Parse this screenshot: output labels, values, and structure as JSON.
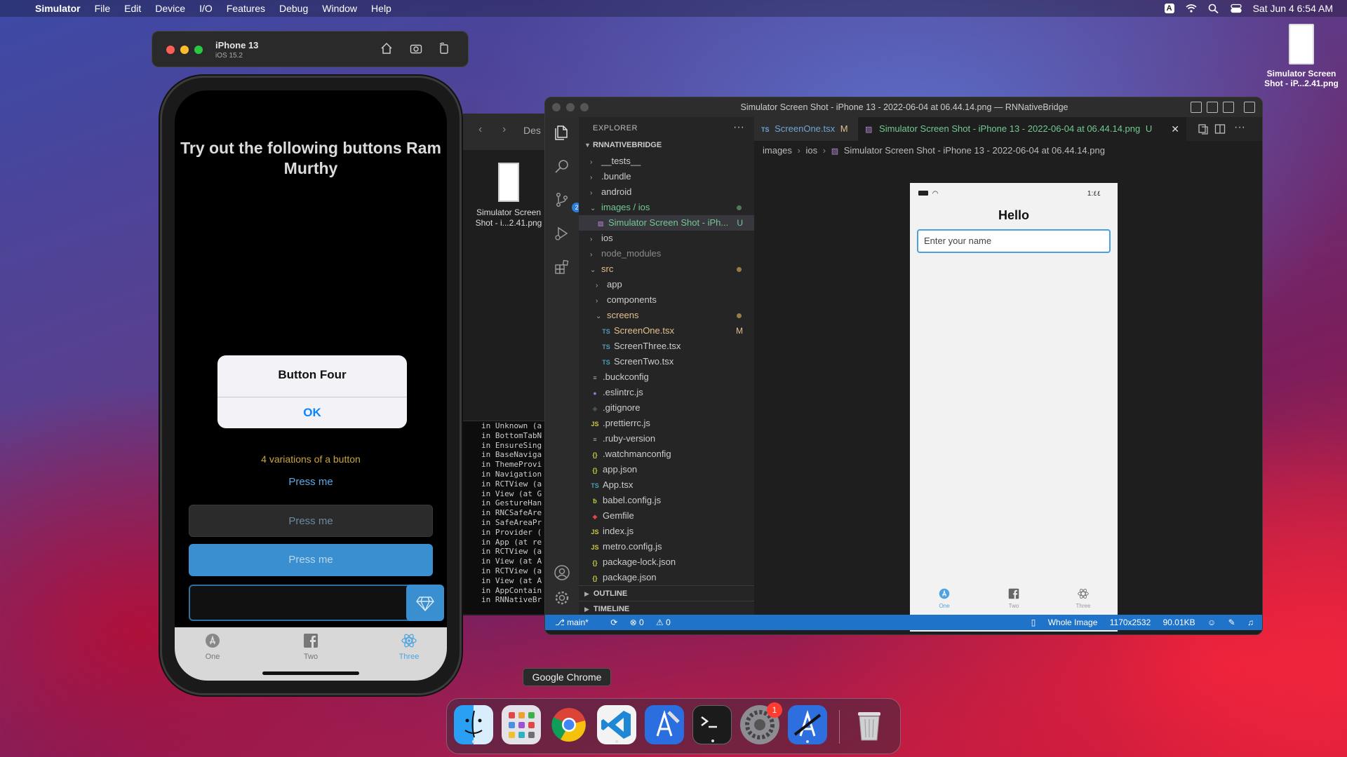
{
  "menubar": {
    "app_name": "Simulator",
    "items": [
      "File",
      "Edit",
      "Device",
      "I/O",
      "Features",
      "Debug",
      "Window",
      "Help"
    ],
    "datetime": "Sat Jun 4  6:54 AM",
    "input_badge": "A"
  },
  "desktop_file": {
    "label_line1": "Simulator Screen",
    "label_line2": "Shot - iP...2.41.png"
  },
  "simulator": {
    "device_name": "iPhone 13",
    "ios_version": "iOS 15.2",
    "screen": {
      "title": "Try out the following buttons Ram Murthy",
      "alert_title": "Button Four",
      "alert_ok": "OK",
      "variations_text": "4 variations of a button",
      "press_link": "Press me",
      "press_dark": "Press me",
      "press_blue": "Press me",
      "tabs": [
        {
          "label": "One",
          "icon": "app-store-icon"
        },
        {
          "label": "Two",
          "icon": "facebook-icon"
        },
        {
          "label": "Three",
          "icon": "react-icon"
        }
      ],
      "active_tab": "Three"
    }
  },
  "finder": {
    "back": "‹",
    "forward": "›",
    "partial_title": "Des",
    "file_label": "Simulator Screen Shot - i...2.41.png"
  },
  "terminal_lines": [
    "in Unknown (a",
    "in BottomTabN",
    "in EnsureSing",
    "in BaseNaviga",
    "in ThemeProvi",
    "in Navigation",
    "in RCTView (a",
    "in View (at G",
    "in GestureHan",
    "in RNCSafeAre",
    "in SafeAreaPr",
    "in Provider (",
    "in App (at re",
    "in RCTView (a",
    "in View (at A",
    "in RCTView (a",
    "in View (at A",
    "in AppContain",
    "in RNNativeBr"
  ],
  "vscode": {
    "window_title": "Simulator Screen Shot - iPhone 13 - 2022-06-04 at 06.44.14.png — RNNativeBridge",
    "explorer_header": "EXPLORER",
    "project": "RNNATIVEBRIDGE",
    "scm_badge": "2",
    "tree": [
      {
        "label": "__tests__",
        "kind": "folder",
        "indent": 1
      },
      {
        "label": ".bundle",
        "kind": "folder",
        "indent": 1
      },
      {
        "label": "android",
        "kind": "folder",
        "indent": 1
      },
      {
        "label": "images / ios",
        "kind": "folder-open",
        "indent": 1,
        "dot": true,
        "color": "#73c991"
      },
      {
        "label": "Simulator Screen Shot - iPh...",
        "kind": "image",
        "indent": 2,
        "status": "U",
        "color": "#73c991",
        "selected": true
      },
      {
        "label": "ios",
        "kind": "folder",
        "indent": 1
      },
      {
        "label": "node_modules",
        "kind": "folder",
        "indent": 1,
        "color": "#8b8b8b"
      },
      {
        "label": "src",
        "kind": "folder-open",
        "indent": 1,
        "dot": true,
        "color": "#e2c08d"
      },
      {
        "label": "app",
        "kind": "folder",
        "indent": 2
      },
      {
        "label": "components",
        "kind": "folder",
        "indent": 2
      },
      {
        "label": "screens",
        "kind": "folder-open",
        "indent": 2,
        "dot": true,
        "color": "#e2c08d"
      },
      {
        "label": "ScreenOne.tsx",
        "kind": "ts",
        "indent": 3,
        "status": "M",
        "color": "#e2c08d"
      },
      {
        "label": "ScreenThree.tsx",
        "kind": "ts",
        "indent": 3
      },
      {
        "label": "ScreenTwo.tsx",
        "kind": "ts",
        "indent": 3
      },
      {
        "label": ".buckconfig",
        "kind": "lines",
        "indent": 1
      },
      {
        "label": ".eslintrc.js",
        "kind": "eslint",
        "indent": 1
      },
      {
        "label": ".gitignore",
        "kind": "git",
        "indent": 1
      },
      {
        "label": ".prettierrc.js",
        "kind": "js",
        "indent": 1
      },
      {
        "label": ".ruby-version",
        "kind": "lines",
        "indent": 1
      },
      {
        "label": ".watchmanconfig",
        "kind": "json",
        "indent": 1
      },
      {
        "label": "app.json",
        "kind": "json",
        "indent": 1
      },
      {
        "label": "App.tsx",
        "kind": "ts",
        "indent": 1
      },
      {
        "label": "babel.config.js",
        "kind": "babel",
        "indent": 1
      },
      {
        "label": "Gemfile",
        "kind": "ruby",
        "indent": 1
      },
      {
        "label": "index.js",
        "kind": "js",
        "indent": 1
      },
      {
        "label": "metro.config.js",
        "kind": "js",
        "indent": 1
      },
      {
        "label": "package-lock.json",
        "kind": "json",
        "indent": 1
      },
      {
        "label": "package.json",
        "kind": "json",
        "indent": 1
      }
    ],
    "outline": "OUTLINE",
    "timeline": "TIMELINE",
    "tab_inactive": "ScreenOne.tsx",
    "tab_inactive_status": "M",
    "tab_active": "Simulator Screen Shot - iPhone 13 - 2022-06-04 at 06.44.14.png",
    "tab_active_status": "U",
    "breadcrumbs": [
      "images",
      "ios",
      "Simulator Screen Shot - iPhone 13 - 2022-06-04 at 06.44.14.png"
    ],
    "preview": {
      "time": "1:٤٤",
      "heading": "Hello",
      "input_placeholder": "Enter your name",
      "tabs": [
        "One",
        "Two",
        "Three"
      ]
    },
    "statusbar": {
      "branch": "main*",
      "errors": "0",
      "warnings": "0",
      "zoom": "Whole Image",
      "dimensions": "1170x2532",
      "size": "90.01KB"
    }
  },
  "dock": {
    "tooltip": "Google Chrome",
    "apps": [
      {
        "name": "finder-icon",
        "color": "#1e8ef0"
      },
      {
        "name": "launchpad-icon",
        "color": "#d9d9e0"
      },
      {
        "name": "chrome-icon",
        "color": "#ffffff"
      },
      {
        "name": "vscode-icon",
        "color": "#ffffff"
      },
      {
        "name": "xcode-beta-icon",
        "color": "#3a7be8"
      },
      {
        "name": "terminal-icon",
        "color": "#1b1b1b"
      },
      {
        "name": "system-preferences-icon",
        "color": "#8c8c92"
      },
      {
        "name": "simulator-beta-icon",
        "color": "#2e6fe0"
      },
      {
        "name": "trash-icon",
        "color": "#c8c8cc"
      }
    ],
    "settings_badge": "1"
  }
}
